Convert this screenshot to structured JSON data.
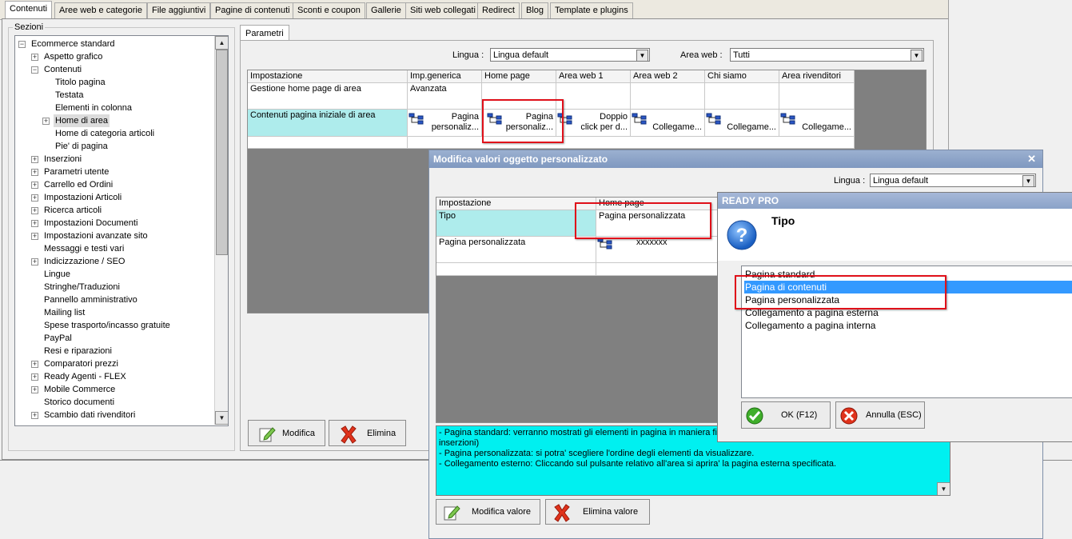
{
  "tabs": [
    "Contenuti",
    "Aree web e categorie",
    "File aggiuntivi",
    "Pagine di contenuti",
    "Sconti e coupon",
    "Gallerie",
    "Siti web collegati",
    "Redirect",
    "Blog",
    "Template e plugins"
  ],
  "sections": {
    "label": "Sezioni",
    "items": [
      {
        "label": "Ecommerce standard",
        "level": 0,
        "expander": "−"
      },
      {
        "label": "Aspetto grafico",
        "level": 1,
        "expander": "+"
      },
      {
        "label": "Contenuti",
        "level": 1,
        "expander": "−"
      },
      {
        "label": "Titolo pagina",
        "level": 2,
        "expander": ""
      },
      {
        "label": "Testata",
        "level": 2,
        "expander": ""
      },
      {
        "label": "Elementi in colonna",
        "level": 2,
        "expander": ""
      },
      {
        "label": "Home di area",
        "level": 2,
        "expander": "+",
        "selected": true
      },
      {
        "label": "Home di categoria articoli",
        "level": 2,
        "expander": ""
      },
      {
        "label": "Pie' di pagina",
        "level": 2,
        "expander": ""
      },
      {
        "label": "Inserzioni",
        "level": 1,
        "expander": "+"
      },
      {
        "label": "Parametri utente",
        "level": 1,
        "expander": "+"
      },
      {
        "label": "Carrello ed Ordini",
        "level": 1,
        "expander": "+"
      },
      {
        "label": "Impostazioni Articoli",
        "level": 1,
        "expander": "+"
      },
      {
        "label": "Ricerca articoli",
        "level": 1,
        "expander": "+"
      },
      {
        "label": "Impostazioni Documenti",
        "level": 1,
        "expander": "+"
      },
      {
        "label": "Impostazioni avanzate sito",
        "level": 1,
        "expander": "+"
      },
      {
        "label": "Messaggi e testi vari",
        "level": 1,
        "expander": ""
      },
      {
        "label": "Indicizzazione / SEO",
        "level": 1,
        "expander": "+"
      },
      {
        "label": "Lingue",
        "level": 1,
        "expander": ""
      },
      {
        "label": "Stringhe/Traduzioni",
        "level": 1,
        "expander": ""
      },
      {
        "label": "Pannello amministrativo",
        "level": 1,
        "expander": ""
      },
      {
        "label": "Mailing list",
        "level": 1,
        "expander": ""
      },
      {
        "label": "Spese trasporto/incasso gratuite",
        "level": 1,
        "expander": ""
      },
      {
        "label": "PayPal",
        "level": 1,
        "expander": ""
      },
      {
        "label": "Resi e riparazioni",
        "level": 1,
        "expander": ""
      },
      {
        "label": "Comparatori prezzi",
        "level": 1,
        "expander": "+"
      },
      {
        "label": "Ready Agenti - FLEX",
        "level": 1,
        "expander": "+"
      },
      {
        "label": "Mobile Commerce",
        "level": 1,
        "expander": "+"
      },
      {
        "label": "Storico documenti",
        "level": 1,
        "expander": ""
      },
      {
        "label": "Scambio dati rivenditori",
        "level": 1,
        "expander": "+"
      }
    ]
  },
  "params": {
    "tab": "Parametri",
    "lingua_label": "Lingua :",
    "lingua_value": "Lingua default",
    "area_label": "Area web :",
    "area_value": "Tutti",
    "headers": [
      "Impostazione",
      "Imp.generica",
      "Home page",
      "Area web 1",
      "Area web 2",
      "Chi siamo",
      "Area rivenditori"
    ],
    "rows": [
      {
        "name": "Gestione home page di area",
        "cells": [
          "Avanzata",
          "",
          "",
          "",
          "",
          ""
        ]
      },
      {
        "name": "Contenuti pagina iniziale di area",
        "cells": [
          "Pagina personaliz...",
          "Pagina personaliz...",
          "Doppio click per d...",
          "Collegame...",
          "Collegame...",
          "Collegame..."
        ]
      }
    ],
    "cell_lines": {
      "c0": [
        "Pagina",
        "personaliz..."
      ],
      "c1": [
        "Pagina",
        "personaliz..."
      ],
      "c2": [
        "Doppio",
        "click per d..."
      ]
    },
    "modifica": "Modifica",
    "elimina": "Elimina"
  },
  "dialog": {
    "title": "Modifica valori oggetto personalizzato",
    "lingua_label": "Lingua :",
    "lingua_value": "Lingua default",
    "headers": [
      "Impostazione",
      "Home page"
    ],
    "rows": [
      {
        "name": "Tipo",
        "value": "Pagina personalizzata"
      },
      {
        "name": "Pagina personalizzata",
        "value": "xxxxxxx"
      }
    ],
    "description": [
      "- Pagina standard: verranno mostrati gli elementi in pagina in maniera fiss",
      "inserzioni)",
      "- Pagina personalizzata: si potra' scegliere l'ordine degli elementi da visualizzare.",
      "- Collegamento esterno: Cliccando sul pulsante relativo all'area si aprira' la pagina esterna specificata."
    ],
    "modifica_valore": "Modifica valore",
    "elimina_valore": "Elimina valore"
  },
  "ready": {
    "title": "READY PRO",
    "heading": "Tipo",
    "options": [
      "Pagina standard",
      "Pagina di contenuti",
      "Pagina personalizzata",
      "Collegamento a pagina esterna",
      "Collegamento a pagina interna"
    ],
    "selected_index": 1,
    "ok": "OK (F12)",
    "annulla": "Annulla (ESC)"
  },
  "colors": {
    "cyan": "#aeecec",
    "selection": "#3399ff",
    "highlight_red": "#e0101a",
    "description_bg": "#00f0f0"
  }
}
